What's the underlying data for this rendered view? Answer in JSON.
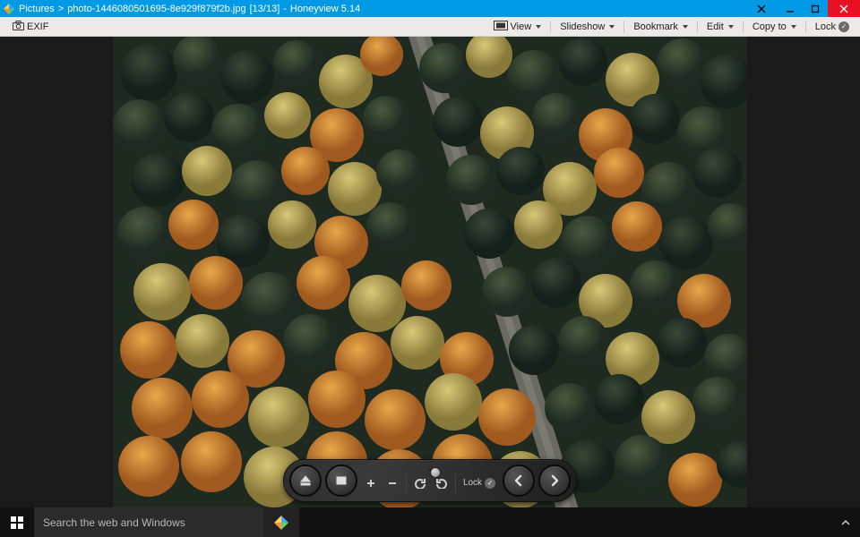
{
  "title": {
    "folder": "Pictures",
    "sep1": ">",
    "filename": "photo-1446080501695-8e929f879f2b.jpg",
    "counter": "[13/13]",
    "sep2": "-",
    "app": "Honeyview 5.14"
  },
  "window_controls": {
    "minimize": "_",
    "maximize": "❐",
    "close": "✕"
  },
  "toolbar": {
    "exif": "EXIF",
    "view": "View",
    "slideshow": "Slideshow",
    "bookmark": "Bookmark",
    "edit": "Edit",
    "copyto": "Copy to",
    "lock": "Lock"
  },
  "floatbar": {
    "lock": "Lock"
  },
  "taskbar": {
    "search_placeholder": "Search the web and Windows"
  }
}
